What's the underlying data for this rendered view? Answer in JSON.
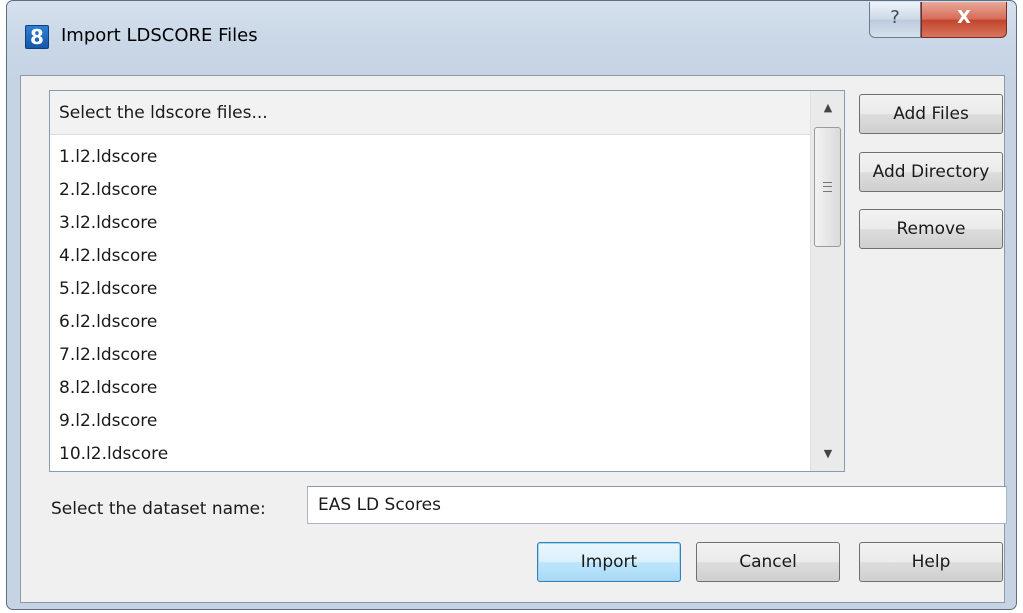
{
  "window": {
    "title": "Import LDSCORE Files",
    "app_icon_glyph": "8",
    "help_glyph": "?",
    "close_glyph": "X"
  },
  "list": {
    "header": "Select the ldscore files...",
    "items": [
      "1.l2.ldscore",
      "2.l2.ldscore",
      "3.l2.ldscore",
      "4.l2.ldscore",
      "5.l2.ldscore",
      "6.l2.ldscore",
      "7.l2.ldscore",
      "8.l2.ldscore",
      "9.l2.ldscore",
      "10.l2.ldscore"
    ],
    "scroll_up_icon": "scroll-up-arrow-icon",
    "scroll_down_icon": "scroll-down-arrow-icon"
  },
  "side_buttons": {
    "add_files": "Add Files",
    "add_directory": "Add Directory",
    "remove": "Remove"
  },
  "dataset": {
    "label": "Select the dataset name:",
    "value": "EAS LD Scores"
  },
  "footer": {
    "import": "Import",
    "cancel": "Cancel",
    "help": "Help"
  },
  "colors": {
    "frame": "#c5d3e4",
    "client": "#f0f0f0",
    "close_button": "#c2432c",
    "default_button": "#bee6fd"
  }
}
